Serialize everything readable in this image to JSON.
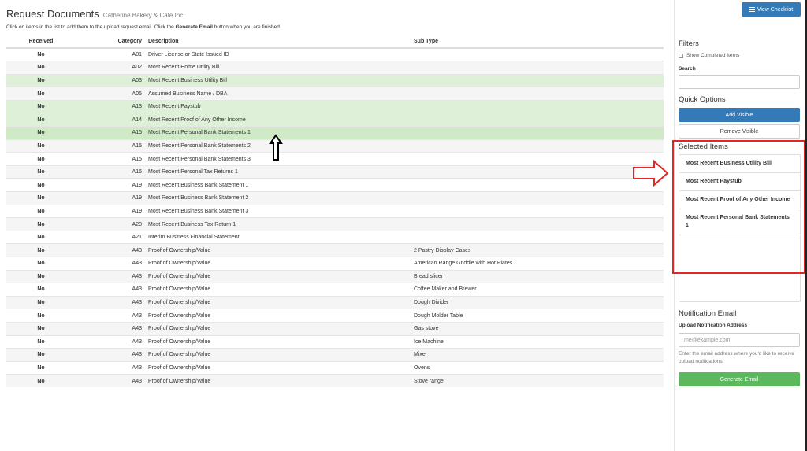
{
  "header": {
    "title": "Request Documents",
    "subtitle": "Catherine Bakery & Cafe Inc.",
    "instructions_before": "Click on items in the list to add them to the upload request email. Click the",
    "instructions_bold": "Generate Email",
    "instructions_after": "button when you are finished."
  },
  "toolbar": {
    "view_checklist_label": "View Checklist",
    "view_checklist_icon": "list-icon"
  },
  "table": {
    "headers": {
      "received": "Received",
      "category": "Category",
      "description": "Description",
      "subtype": "Sub Type"
    },
    "rows": [
      {
        "received": "No",
        "category": "A01",
        "description": "Driver License or State Issued ID",
        "subtype": "",
        "selected": false
      },
      {
        "received": "No",
        "category": "A02",
        "description": "Most Recent Home Utility Bill",
        "subtype": "",
        "selected": false
      },
      {
        "received": "No",
        "category": "A03",
        "description": "Most Recent Business Utility Bill",
        "subtype": "",
        "selected": true
      },
      {
        "received": "No",
        "category": "A05",
        "description": "Assumed Business Name / DBA",
        "subtype": "",
        "selected": false
      },
      {
        "received": "No",
        "category": "A13",
        "description": "Most Recent Paystub",
        "subtype": "",
        "selected": true
      },
      {
        "received": "No",
        "category": "A14",
        "description": "Most Recent Proof of Any Other Income",
        "subtype": "",
        "selected": true
      },
      {
        "received": "No",
        "category": "A15",
        "description": "Most Recent Personal Bank Statements 1",
        "subtype": "",
        "selected": true,
        "hover": true
      },
      {
        "received": "No",
        "category": "A15",
        "description": "Most Recent Personal Bank Statements 2",
        "subtype": "",
        "selected": false
      },
      {
        "received": "No",
        "category": "A15",
        "description": "Most Recent Personal Bank Statements 3",
        "subtype": "",
        "selected": false
      },
      {
        "received": "No",
        "category": "A16",
        "description": "Most Recent Personal Tax Returns 1",
        "subtype": "",
        "selected": false
      },
      {
        "received": "No",
        "category": "A19",
        "description": "Most Recent Business Bank Statement 1",
        "subtype": "",
        "selected": false
      },
      {
        "received": "No",
        "category": "A19",
        "description": "Most Recent Business Bank Statement 2",
        "subtype": "",
        "selected": false
      },
      {
        "received": "No",
        "category": "A19",
        "description": "Most Recent Business Bank Statement 3",
        "subtype": "",
        "selected": false
      },
      {
        "received": "No",
        "category": "A20",
        "description": "Most Recent Business Tax Return 1",
        "subtype": "",
        "selected": false
      },
      {
        "received": "No",
        "category": "A21",
        "description": "Interim Business Financial Statement",
        "subtype": "",
        "selected": false
      },
      {
        "received": "No",
        "category": "A43",
        "description": "Proof of Ownership/Value",
        "subtype": "2 Pastry Display Cases",
        "selected": false
      },
      {
        "received": "No",
        "category": "A43",
        "description": "Proof of Ownership/Value",
        "subtype": "American Range Griddle with Hot Plates",
        "selected": false
      },
      {
        "received": "No",
        "category": "A43",
        "description": "Proof of Ownership/Value",
        "subtype": "Bread slicer",
        "selected": false
      },
      {
        "received": "No",
        "category": "A43",
        "description": "Proof of Ownership/Value",
        "subtype": "Coffee Maker and Brewer",
        "selected": false
      },
      {
        "received": "No",
        "category": "A43",
        "description": "Proof of Ownership/Value",
        "subtype": "Dough Divider",
        "selected": false
      },
      {
        "received": "No",
        "category": "A43",
        "description": "Proof of Ownership/Value",
        "subtype": "Dough Molder Table",
        "selected": false
      },
      {
        "received": "No",
        "category": "A43",
        "description": "Proof of Ownership/Value",
        "subtype": "Gas stove",
        "selected": false
      },
      {
        "received": "No",
        "category": "A43",
        "description": "Proof of Ownership/Value",
        "subtype": "Ice Machine",
        "selected": false
      },
      {
        "received": "No",
        "category": "A43",
        "description": "Proof of Ownership/Value",
        "subtype": "Mixer",
        "selected": false
      },
      {
        "received": "No",
        "category": "A43",
        "description": "Proof of Ownership/Value",
        "subtype": "Ovens",
        "selected": false
      },
      {
        "received": "No",
        "category": "A43",
        "description": "Proof of Ownership/Value",
        "subtype": "Stove range",
        "selected": false
      }
    ]
  },
  "sidebar": {
    "filters_heading": "Filters",
    "show_completed_label": "Show Completed Items",
    "search_label": "Search",
    "search_value": "",
    "quick_options_heading": "Quick Options",
    "add_visible_label": "Add Visible",
    "remove_visible_label": "Remove Visible",
    "selected_heading": "Selected Items",
    "selected_items": [
      "Most Recent Business Utility Bill",
      "Most Recent Paystub",
      "Most Recent Proof of Any Other Income",
      "Most Recent Personal Bank Statements 1"
    ],
    "notification_heading": "Notification Email",
    "notification_label": "Upload Notification Address",
    "email_placeholder": "me@example.com",
    "email_help": "Enter the email address where you'd like to receive upload notifications.",
    "generate_email_label": "Generate Email"
  },
  "annotations": {
    "highlight_color": "#e32526",
    "arrow_color": "#000000"
  },
  "colors": {
    "primary": "#337ab7",
    "success": "#5cb85c",
    "selected_row": "#dff0d8",
    "hover_row": "#d0e9c6"
  }
}
